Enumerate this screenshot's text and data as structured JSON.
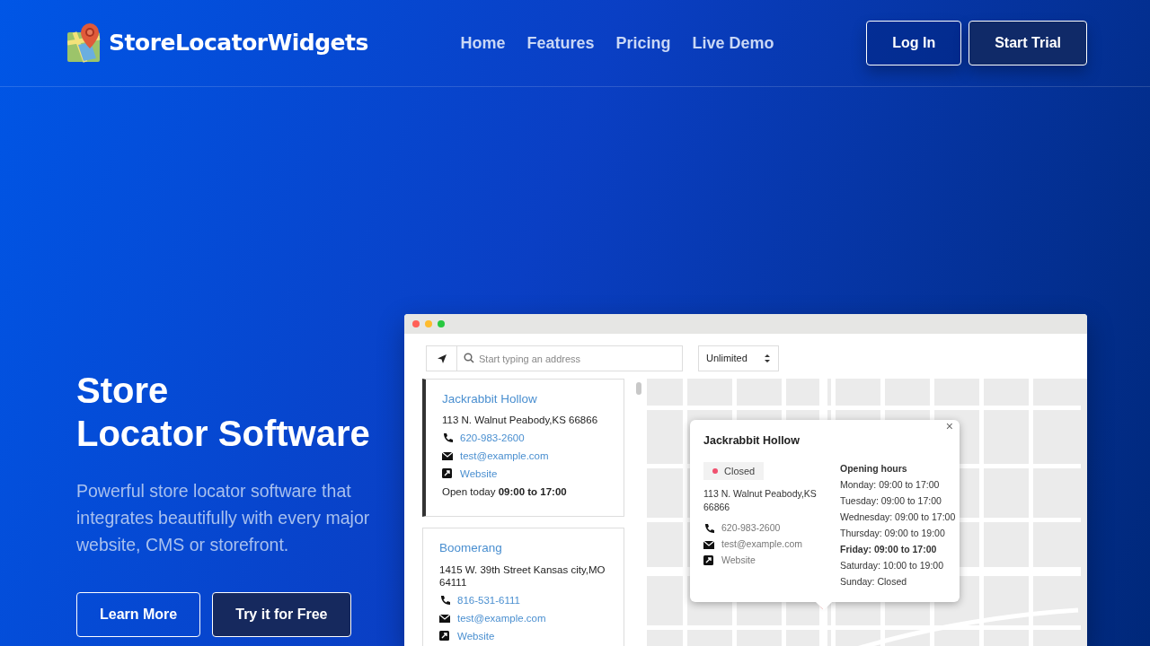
{
  "brand": {
    "name": "StoreLocatorWidgets"
  },
  "nav": [
    {
      "label": "Home"
    },
    {
      "label": "Features"
    },
    {
      "label": "Pricing"
    },
    {
      "label": "Live Demo"
    }
  ],
  "actions": [
    {
      "label": "Log In",
      "kind": "outline"
    },
    {
      "label": "Start Trial",
      "kind": "solid"
    }
  ],
  "hero": {
    "title_lines": [
      "Store",
      "Locator Software"
    ],
    "lead": "Powerful store locator software that integrates beautifully with every major website, CMS or storefront.",
    "buttons": [
      {
        "label": "Learn More",
        "kind": "outline"
      },
      {
        "label": "Try it for Free",
        "kind": "solid"
      }
    ]
  },
  "demo": {
    "window_dots": [
      {
        "color": "#ff5f57"
      },
      {
        "color": "#febc2e"
      },
      {
        "color": "#28c840"
      }
    ],
    "search": {
      "placeholder": "Start typing an address"
    },
    "limit_select": {
      "value": "Unlimited"
    },
    "stores": [
      {
        "name": "Jackrabbit Hollow",
        "address": "113 N. Walnut Peabody,KS 66866",
        "phone": "620-983-2600",
        "email": "test@example.com",
        "website": "Website",
        "hours_label": "Open today",
        "hours": "09:00 to 17:00",
        "selected": true
      },
      {
        "name": "Boomerang",
        "address": "1415 W. 39th Street Kansas city,MO 64111",
        "phone": "816-531-6111",
        "email": "test@example.com",
        "website": "Website",
        "selected": false
      }
    ],
    "popup": {
      "name": "Jackrabbit Hollow",
      "close_label": "×",
      "status": "Closed",
      "open": false,
      "address": "113 N. Walnut Peabody,KS 66866",
      "phone": "620-983-2600",
      "email": "test@example.com",
      "website": "Website",
      "hours_title": "Opening hours",
      "hours": [
        {
          "text": "Monday: 09:00 to 17:00",
          "today": false
        },
        {
          "text": "Tuesday: 09:00 to 17:00",
          "today": false
        },
        {
          "text": "Wednesday: 09:00 to 17:00",
          "today": false
        },
        {
          "text": "Thursday: 09:00 to 19:00",
          "today": false
        },
        {
          "text": "Friday: 09:00 to 17:00",
          "today": true
        },
        {
          "text": "Saturday: 10:00 to 19:00",
          "today": false
        },
        {
          "text": "Sunday: Closed",
          "today": false
        }
      ]
    }
  }
}
